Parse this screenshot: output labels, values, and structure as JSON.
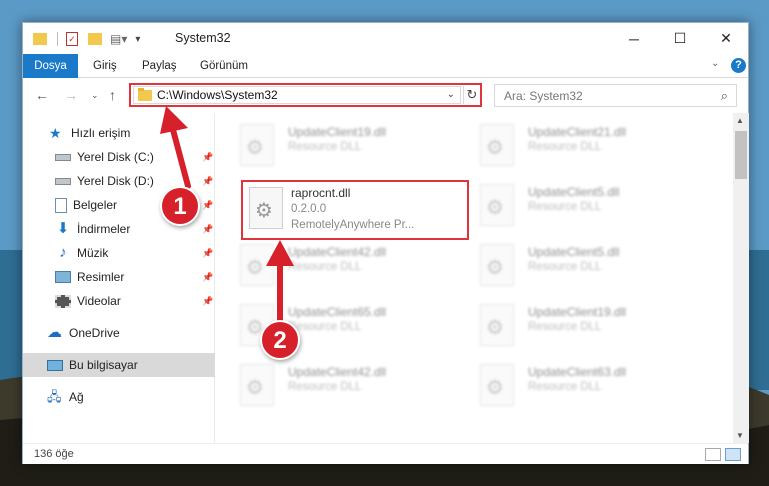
{
  "window": {
    "title": "System32"
  },
  "ribbon": {
    "tabs": [
      "Dosya",
      "Giriş",
      "Paylaş",
      "Görünüm"
    ]
  },
  "navbar": {
    "address": "C:\\Windows\\System32",
    "search_placeholder": "Ara: System32"
  },
  "sidebar": {
    "items": [
      {
        "label": "Hızlı erişim",
        "icon": "star-icon",
        "pinned": false
      },
      {
        "label": "Yerel Disk (C:)",
        "icon": "drive-icon",
        "pinned": true
      },
      {
        "label": "Yerel Disk (D:)",
        "icon": "drive-icon",
        "pinned": true
      },
      {
        "label": "Belgeler",
        "icon": "documents-icon",
        "pinned": true
      },
      {
        "label": "İndirmeler",
        "icon": "download-icon",
        "pinned": true
      },
      {
        "label": "Müzik",
        "icon": "music-icon",
        "pinned": true
      },
      {
        "label": "Resimler",
        "icon": "pictures-icon",
        "pinned": true
      },
      {
        "label": "Videolar",
        "icon": "video-icon",
        "pinned": true
      },
      {
        "label": "OneDrive",
        "icon": "cloud-icon",
        "pinned": false
      },
      {
        "label": "Bu bilgisayar",
        "icon": "computer-icon",
        "pinned": false,
        "selected": true
      },
      {
        "label": "Ağ",
        "icon": "network-icon",
        "pinned": false
      }
    ]
  },
  "files": {
    "col1": [
      {
        "name": "UpdateClient19.dll",
        "line1": "Resource DLL"
      },
      {
        "name": "raprocnt.dll",
        "line1": "0.2.0.0",
        "line2": "RemotelyAnywhere Pr...",
        "highlight": true
      },
      {
        "name": "UpdateClient42.dll",
        "line1": "Resource DLL"
      },
      {
        "name": "UpdateClient65.dll",
        "line1": "Resource DLL"
      },
      {
        "name": "UpdateClient42.dll",
        "line1": "Resource DLL"
      }
    ],
    "col2": [
      {
        "name": "UpdateClient21.dll",
        "line1": "Resource DLL"
      },
      {
        "name": "UpdateClient5.dll",
        "line1": "Resource DLL"
      },
      {
        "name": "UpdateClient5.dll",
        "line1": "Resource DLL"
      },
      {
        "name": "UpdateClient19.dll",
        "line1": "Resource DLL"
      },
      {
        "name": "UpdateClient63.dll",
        "line1": "Resource DLL"
      }
    ]
  },
  "status": {
    "count": "136 öğe"
  },
  "annotations": {
    "step1": "1",
    "step2": "2",
    "color": "#d6212a"
  }
}
